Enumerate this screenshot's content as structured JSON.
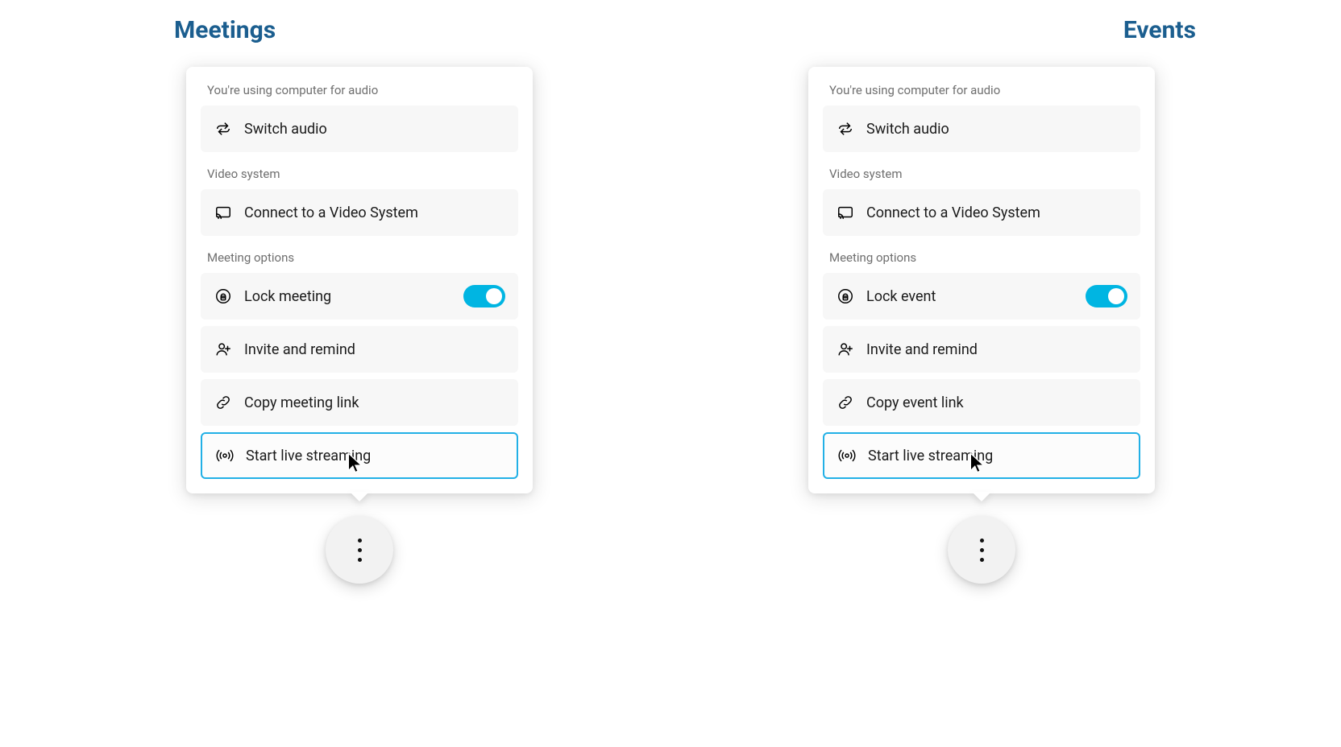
{
  "titles": {
    "left": "Meetings",
    "right": "Events"
  },
  "labels": {
    "audio_status": "You're using computer for audio",
    "video_system": "Video system",
    "meeting_options": "Meeting options"
  },
  "left_panel": {
    "switch_audio": "Switch audio",
    "connect_video": "Connect to a Video System",
    "lock": "Lock meeting",
    "invite": "Invite and remind",
    "copy_link": "Copy meeting link",
    "start_stream": "Start live streaming"
  },
  "right_panel": {
    "switch_audio": "Switch audio",
    "connect_video": "Connect to a Video System",
    "lock": "Lock event",
    "invite": "Invite and remind",
    "copy_link": "Copy event link",
    "start_stream": "Start live streaming"
  },
  "colors": {
    "title": "#1b5e8f",
    "highlight_border": "#22b0e6",
    "toggle_on": "#00b5e2"
  }
}
